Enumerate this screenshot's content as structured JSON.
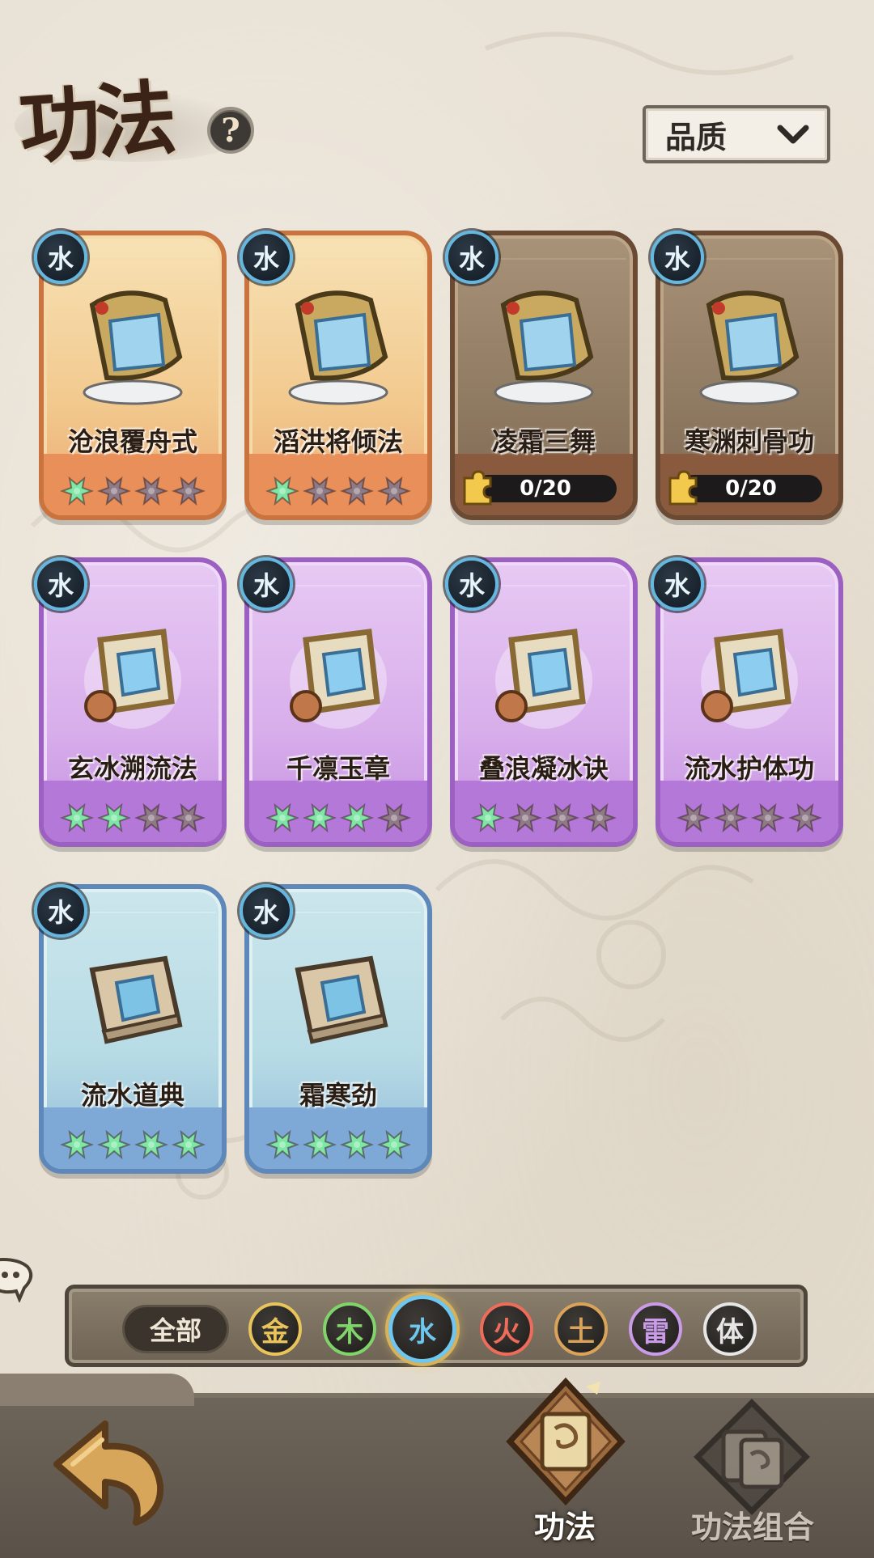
{
  "header": {
    "title": "功法",
    "help_icon": "?",
    "sort_dropdown": {
      "label": "品质",
      "icon": "chevron-down-icon"
    }
  },
  "cards": [
    {
      "name": "沧浪覆舟式",
      "element": "水",
      "rarity": "orange",
      "stars": 4,
      "stars_filled": 1,
      "owned": true
    },
    {
      "name": "滔洪将倾法",
      "element": "水",
      "rarity": "orange",
      "stars": 4,
      "stars_filled": 1,
      "owned": true
    },
    {
      "name": "凌霜三舞",
      "element": "水",
      "rarity": "orange",
      "owned": false,
      "progress": "0/20"
    },
    {
      "name": "寒渊刺骨功",
      "element": "水",
      "rarity": "orange",
      "owned": false,
      "progress": "0/20"
    },
    {
      "name": "玄冰溯流法",
      "element": "水",
      "rarity": "purple",
      "stars": 4,
      "stars_filled": 1.5,
      "owned": true
    },
    {
      "name": "千凛玉章",
      "element": "水",
      "rarity": "purple",
      "stars": 4,
      "stars_filled": 3,
      "owned": true
    },
    {
      "name": "叠浪凝冰诀",
      "element": "水",
      "rarity": "purple",
      "stars": 4,
      "stars_filled": 1,
      "owned": true
    },
    {
      "name": "流水护体功",
      "element": "水",
      "rarity": "purple",
      "stars": 4,
      "stars_filled": 0,
      "owned": true
    },
    {
      "name": "流水道典",
      "element": "水",
      "rarity": "blue",
      "stars": 4,
      "stars_filled": 4,
      "owned": true
    },
    {
      "name": "霜寒劲",
      "element": "水",
      "rarity": "blue",
      "stars": 4,
      "stars_filled": 4,
      "owned": true
    }
  ],
  "filter": {
    "all_label": "全部",
    "elements": [
      {
        "label": "金",
        "color": "#e8c45a",
        "active": false
      },
      {
        "label": "木",
        "color": "#7fd46a",
        "active": false
      },
      {
        "label": "水",
        "color": "#6fc6ef",
        "active": true
      },
      {
        "label": "火",
        "color": "#ef6b5a",
        "active": false
      },
      {
        "label": "土",
        "color": "#d9a35a",
        "active": false
      },
      {
        "label": "雷",
        "color": "#c99be8",
        "active": false
      },
      {
        "label": "体",
        "color": "#e6e6e6",
        "active": false
      }
    ]
  },
  "bottom_nav": {
    "back_icon": "back-arrow-icon",
    "tabs": [
      {
        "label": "功法",
        "active": true
      },
      {
        "label": "功法组合",
        "active": false
      }
    ]
  },
  "colors": {
    "orange_frame": "#d9864e",
    "purple_frame": "#b274cf",
    "blue_frame": "#6f9ccf",
    "star_filled": "#7fe6a6",
    "star_empty": "#8f7a87"
  }
}
